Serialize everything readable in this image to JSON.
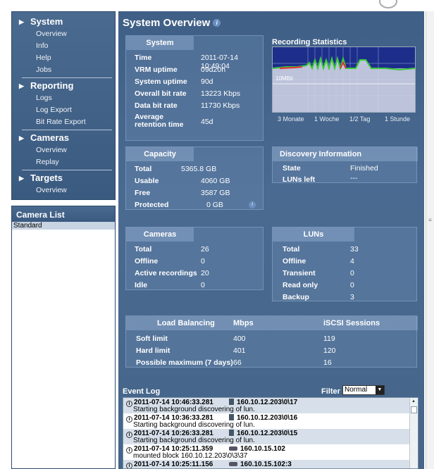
{
  "nav": {
    "groups": [
      {
        "title": "System",
        "items": [
          "Overview",
          "Info",
          "Help",
          "Jobs"
        ]
      },
      {
        "title": "Reporting",
        "items": [
          "Logs",
          "Log Export",
          "Bit Rate Export"
        ]
      },
      {
        "title": "Cameras",
        "items": [
          "Overview",
          "Replay"
        ]
      },
      {
        "title": "Targets",
        "items": [
          "Overview"
        ]
      }
    ]
  },
  "camera_list": {
    "title": "Camera List",
    "selected": "Standard"
  },
  "page": {
    "title": "System Overview"
  },
  "system": {
    "header": "System",
    "rows": [
      {
        "label": "Time",
        "value": "2011-07-14 10:49:04"
      },
      {
        "label": "VRM uptime",
        "value": "09d20h"
      },
      {
        "label": "System uptime",
        "value": "90d"
      },
      {
        "label": "Overall bit rate",
        "value": "13223 Kbps"
      },
      {
        "label": "Data bit rate",
        "value": "11730 Kbps"
      },
      {
        "label": "Average retention time",
        "value": "45d"
      }
    ]
  },
  "recording": {
    "title": "Recording Statistics",
    "marker": "10MBit",
    "axis": [
      "3 Monate",
      "1 Woche",
      "1/2 Tag",
      "1 Stunde"
    ]
  },
  "capacity": {
    "header": "Capacity",
    "rows": [
      {
        "label": "Total",
        "value": "5365.8 GB"
      },
      {
        "label": "Usable",
        "value": "4060 GB"
      },
      {
        "label": "Free",
        "value": "3587 GB"
      },
      {
        "label": "Protected",
        "value": "0 GB"
      }
    ]
  },
  "discovery": {
    "header": "Discovery Information",
    "rows": [
      {
        "label": "State",
        "value": "Finished"
      },
      {
        "label": "LUNs left",
        "value": "---"
      }
    ]
  },
  "cameras": {
    "header": "Cameras",
    "rows": [
      {
        "label": "Total",
        "value": "26"
      },
      {
        "label": "Offline",
        "value": "0"
      },
      {
        "label": "Active recordings",
        "value": "20"
      },
      {
        "label": "Idle",
        "value": "0"
      }
    ]
  },
  "luns": {
    "header": "LUNs",
    "rows": [
      {
        "label": "Total",
        "value": "33"
      },
      {
        "label": "Offline",
        "value": "4"
      },
      {
        "label": "Transient",
        "value": "0"
      },
      {
        "label": "Read only",
        "value": "0"
      },
      {
        "label": "Backup",
        "value": "3"
      }
    ]
  },
  "load": {
    "headers": [
      "Load Balancing",
      "Mbps",
      "iSCSI Sessions"
    ],
    "rows": [
      {
        "label": "Soft limit",
        "mbps": "400",
        "sessions": "119"
      },
      {
        "label": "Hard limit",
        "mbps": "401",
        "sessions": "120"
      },
      {
        "label": "Possible maximum (7 days)",
        "mbps": "66",
        "sessions": "16"
      }
    ]
  },
  "event_log": {
    "label": "Event Log",
    "filter_label": "Filter",
    "filter_value": "Normal",
    "entries": [
      {
        "time": "2011-07-14 10:46:33.281",
        "source": "160.10.12.203\\0\\17",
        "msg": "Starting background discovering of lun."
      },
      {
        "time": "2011-07-14 10:36:33.281",
        "source": "160.10.12.203\\0\\16",
        "msg": "Starting background discovering of lun."
      },
      {
        "time": "2011-07-14 10:26:33.281",
        "source": "160.10.12.203\\0\\15",
        "msg": "Starting background discovering of lun."
      },
      {
        "time": "2011-07-14 10:25:11.359",
        "source": "160.10.15.102",
        "msg": "mounted block 160.10.12.203\\0\\3\\37"
      },
      {
        "time": "2011-07-14 10:25:11.156",
        "source": "160.10.15.102:3",
        "msg": ""
      }
    ]
  },
  "colors": {
    "panel_blue": "#3f5f86",
    "chart_bg": "#1d2e8a",
    "chart_line_green": "#3cc83c",
    "chart_line_red": "#e03030"
  }
}
